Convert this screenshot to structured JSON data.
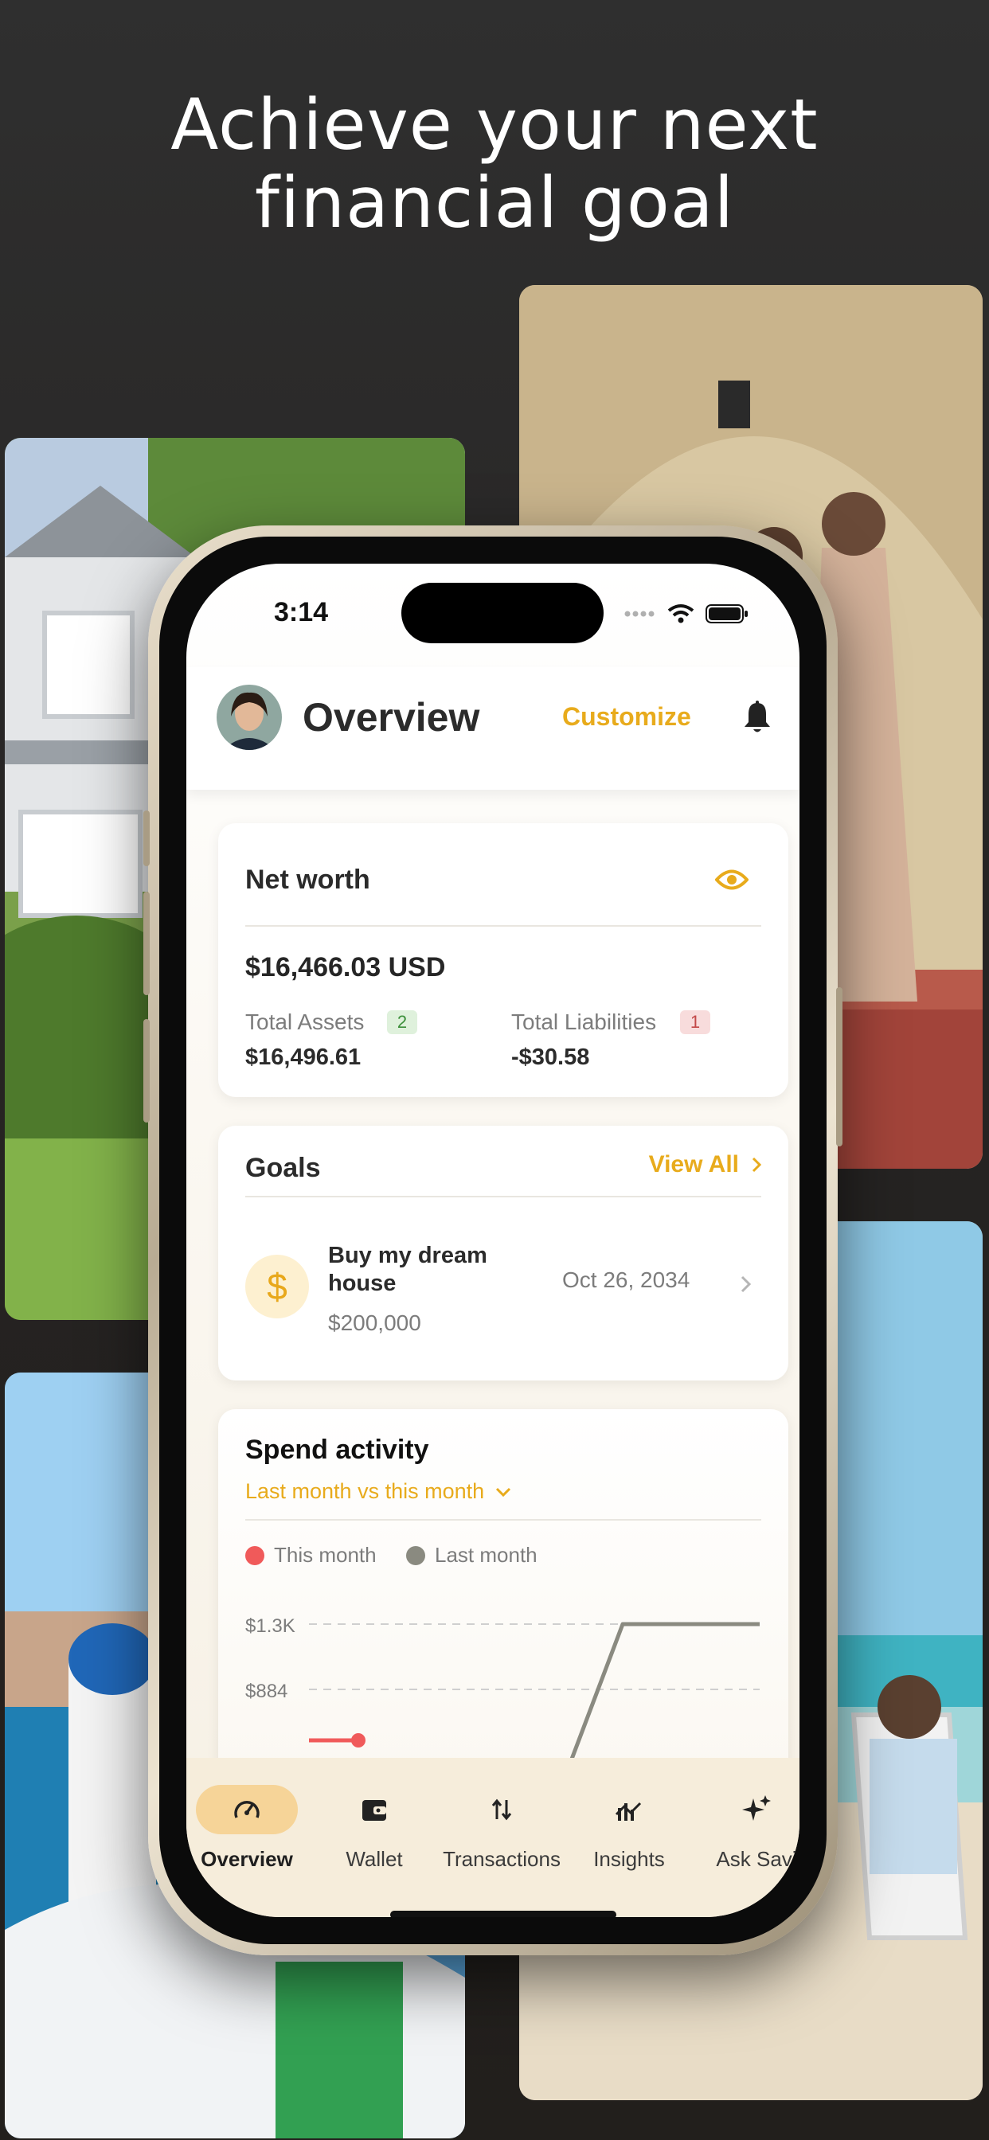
{
  "headline": {
    "line1": "Achieve your next",
    "line2": "financial goal"
  },
  "status_bar": {
    "time": "3:14"
  },
  "header": {
    "title": "Overview",
    "customize_label": "Customize"
  },
  "net_worth": {
    "title": "Net worth",
    "value": "$16,466.03 USD",
    "assets_label": "Total Assets",
    "assets_count": "2",
    "assets_value": "$16,496.61",
    "liabilities_label": "Total Liabilities",
    "liabilities_count": "1",
    "liabilities_value": "-$30.58"
  },
  "goals": {
    "title": "Goals",
    "view_all_label": "View All",
    "items": [
      {
        "name": "Buy my dream house",
        "amount": "$200,000",
        "date": "Oct 26, 2034"
      }
    ]
  },
  "spend_activity": {
    "title": "Spend activity",
    "comparison_label": "Last month vs this month",
    "legend": {
      "this_month": "This month",
      "last_month": "Last month"
    }
  },
  "chart_data": {
    "type": "line",
    "title": "Spend activity",
    "yticks": [
      "$1.3K",
      "$884"
    ],
    "series": [
      {
        "name": "This month",
        "color": "#f05a5a",
        "points": [
          [
            0,
            440
          ],
          [
            1,
            440
          ]
        ]
      },
      {
        "name": "Last month",
        "color": "#8a8a80",
        "points": [
          [
            6,
            440
          ],
          [
            8,
            1300
          ],
          [
            10,
            1300
          ]
        ]
      }
    ],
    "grid": true,
    "legend_position": "top-left"
  },
  "tabs": [
    {
      "label": "Overview",
      "icon": "gauge-icon",
      "active": true
    },
    {
      "label": "Wallet",
      "icon": "wallet-icon",
      "active": false
    },
    {
      "label": "Transactions",
      "icon": "transfer-arrows-icon",
      "active": false
    },
    {
      "label": "Insights",
      "icon": "insights-chart-icon",
      "active": false
    },
    {
      "label": "Ask Savi",
      "icon": "sparkle-icon",
      "active": false
    }
  ],
  "colors": {
    "accent": "#e8ab1c",
    "tab_active_bg": "#f6d498",
    "this_month": "#f05a5a",
    "last_month": "#8a8a80"
  }
}
